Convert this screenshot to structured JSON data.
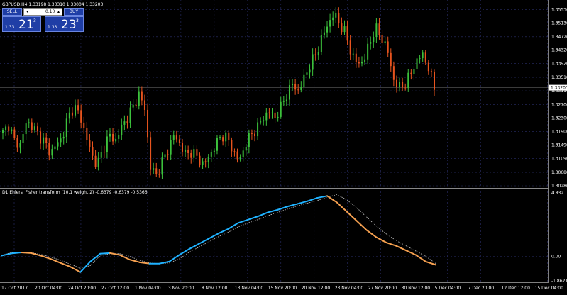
{
  "chart_title": "GBPUSD,H4  1.33198 1.33310 1.33004 1.33203",
  "trade_panel": {
    "sell_label": "SELL",
    "buy_label": "BUY",
    "volume": "0.10",
    "sell_small": "1.33",
    "sell_big": "21",
    "sell_sup": "3",
    "buy_small": "1.33",
    "buy_big": "23",
    "buy_sup": "3"
  },
  "indicator_title": "D1 Ehlers' Fisher transform (10,1 weight 2) -0.6379 -0.6379 -0.5366",
  "price_axis_labels": [
    "1.35530",
    "1.35130",
    "1.34720",
    "1.34320",
    "1.33920",
    "1.33510",
    "1.33110",
    "1.32700",
    "1.32300",
    "1.31900",
    "1.31490",
    "1.31090",
    "1.30680",
    "1.30280"
  ],
  "current_price_label": "1.33203",
  "indicator_axis_labels": [
    "4.832",
    "0.00",
    "-1.8621"
  ],
  "time_labels": [
    "17 Oct 2017",
    "20 Oct 04:00",
    "24 Oct 20:00",
    "27 Oct 12:00",
    "1 Nov 04:00",
    "3 Nov 20:00",
    "8 Nov 12:00",
    "13 Nov 04:00",
    "15 Nov 20:00",
    "20 Nov 12:00",
    "23 Nov 04:00",
    "27 Nov 20:00",
    "30 Nov 12:00",
    "5 Dec 04:00",
    "7 Dec 20:00",
    "12 Dec 12:00",
    "15 Dec 04:00"
  ],
  "colors": {
    "background": "#000000",
    "bull": "#3cc13c",
    "bear": "#e8541e",
    "fisher_up": "#1fb2ff",
    "fisher_down": "#f5a050",
    "signal": "#c8c8c8",
    "grid": "#2b2f6b"
  },
  "chart_data": [
    {
      "type": "candlestick",
      "symbol": "GBPUSD",
      "timeframe": "H4",
      "ylim": [
        1.3028,
        1.3573
      ],
      "close_path": [
        1.3185,
        1.321,
        1.316,
        1.315,
        1.322,
        1.3205,
        1.318,
        1.316,
        1.3125,
        1.315,
        1.317,
        1.323,
        1.3265,
        1.324,
        1.318,
        1.312,
        1.309,
        1.314,
        1.318,
        1.316,
        1.32,
        1.323,
        1.3262,
        1.33,
        1.326,
        1.308,
        1.306,
        1.31,
        1.314,
        1.318,
        1.315,
        1.312,
        1.313,
        1.311,
        1.309,
        1.312,
        1.315,
        1.318,
        1.317,
        1.313,
        1.31,
        1.315,
        1.318,
        1.32,
        1.323,
        1.325,
        1.323,
        1.326,
        1.33,
        1.333,
        1.331,
        1.335,
        1.339,
        1.342,
        1.347,
        1.351,
        1.354,
        1.351,
        1.348,
        1.342,
        1.339,
        1.34,
        1.345,
        1.35,
        1.347,
        1.344,
        1.335,
        1.332,
        1.333,
        1.336,
        1.34,
        1.342,
        1.338,
        1.332
      ],
      "last": 1.33203
    },
    {
      "type": "line",
      "name": "Ehlers' Fisher transform (10,1 weight 2)",
      "ylim": [
        -1.8621,
        4.832
      ],
      "fisher": [
        0.05,
        0.22,
        0.3,
        0.25,
        0.05,
        -0.2,
        -0.5,
        -0.8,
        -1.2,
        -0.4,
        0.2,
        0.25,
        0.1,
        -0.25,
        -0.45,
        -0.55,
        -0.55,
        -0.4,
        0.1,
        0.55,
        0.95,
        1.35,
        1.75,
        2.1,
        2.55,
        2.8,
        3.05,
        3.35,
        3.55,
        3.8,
        4.0,
        4.2,
        4.45,
        4.6,
        4.1,
        3.4,
        2.7,
        2.0,
        1.45,
        1.05,
        0.8,
        0.45,
        0.1,
        -0.4,
        -0.64
      ],
      "signal": [
        0.1,
        0.28,
        0.3,
        0.28,
        0.15,
        -0.05,
        -0.3,
        -0.6,
        -0.9,
        -0.7,
        0.05,
        0.2,
        0.2,
        0.0,
        -0.3,
        -0.5,
        -0.55,
        -0.5,
        -0.2,
        0.3,
        0.7,
        1.1,
        1.5,
        1.85,
        2.25,
        2.55,
        2.8,
        3.1,
        3.35,
        3.6,
        3.85,
        4.05,
        4.25,
        4.5,
        4.7,
        4.3,
        3.7,
        3.0,
        2.3,
        1.7,
        1.2,
        0.8,
        0.4,
        0.0,
        -0.54
      ],
      "values_label": [
        -0.6379,
        -0.6379,
        -0.5366
      ]
    }
  ]
}
